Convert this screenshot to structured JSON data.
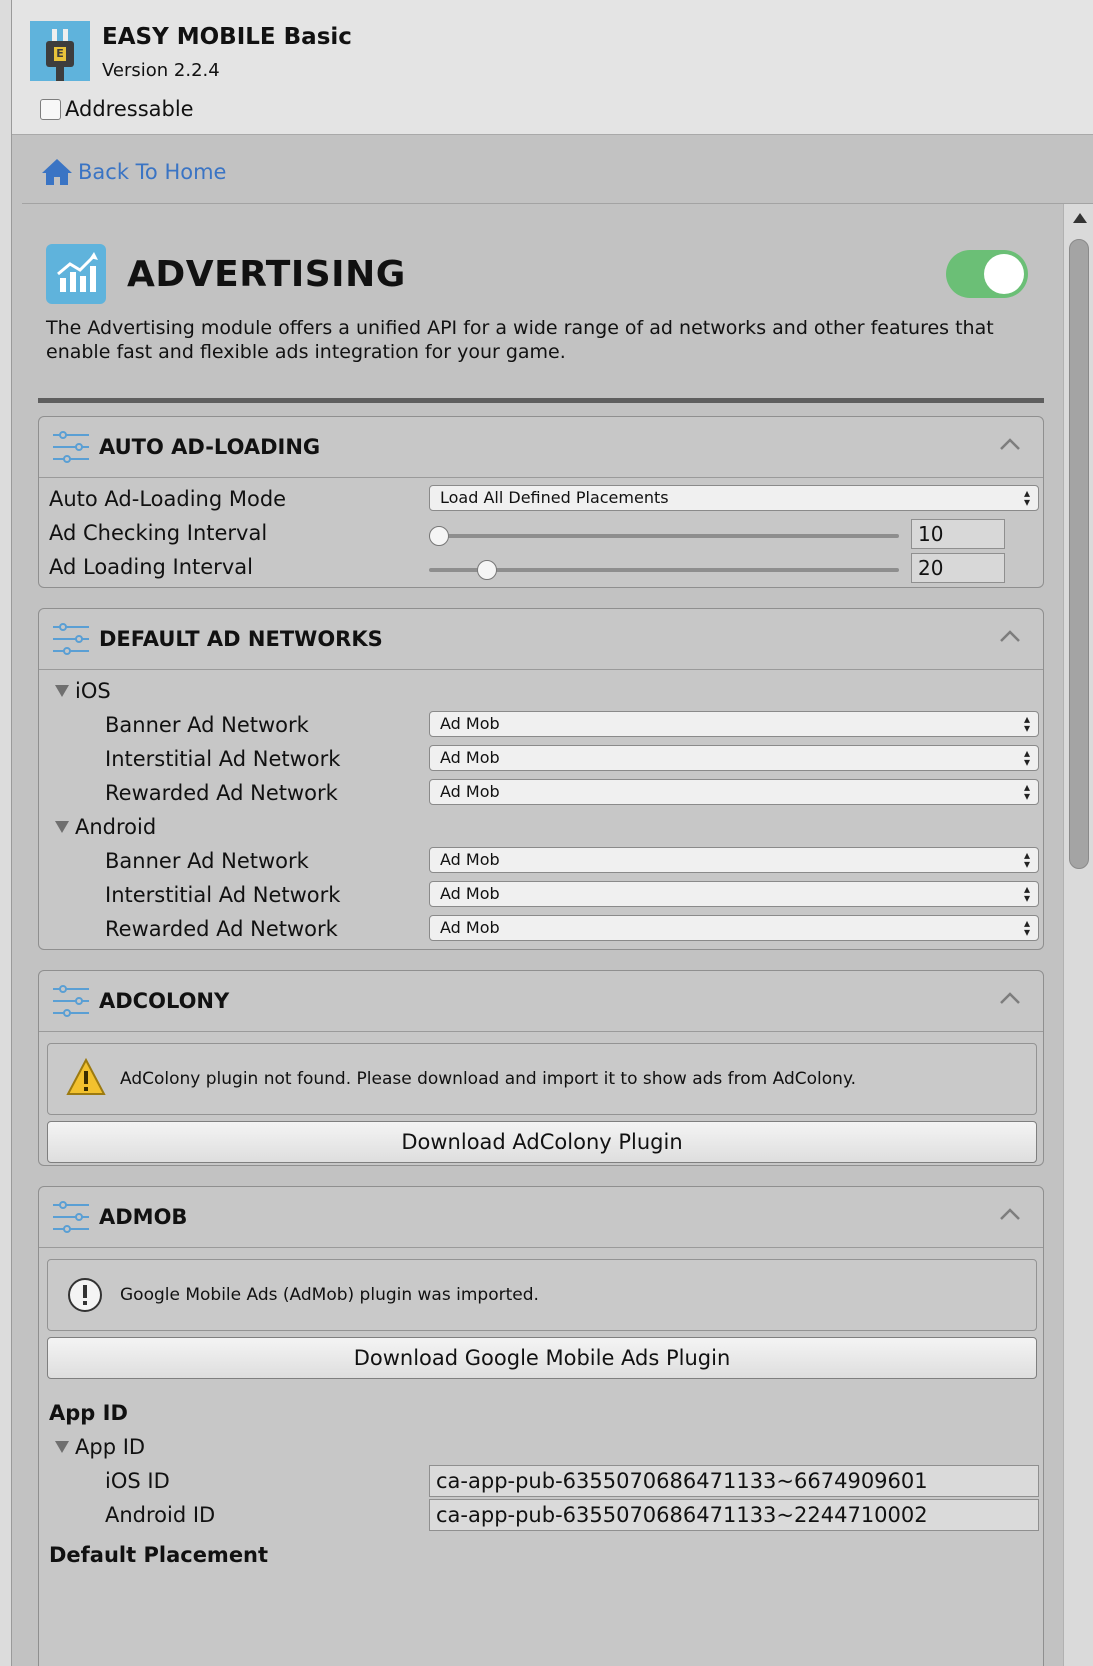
{
  "header": {
    "app_title": "EASY MOBILE Basic",
    "version": "Version 2.2.4",
    "addressable_label": "Addressable",
    "addressable_checked": false
  },
  "nav": {
    "back_label": "Back To Home"
  },
  "module": {
    "title": "ADVERTISING",
    "enabled": true,
    "description": "The Advertising module offers a unified API for a wide range of ad networks and other features that enable fast and flexible ads integration for your game."
  },
  "auto_loading": {
    "title": "AUTO AD-LOADING",
    "mode_label": "Auto Ad-Loading Mode",
    "mode_value": "Load All Defined Placements",
    "checking_label": "Ad Checking Interval",
    "checking_value": "10",
    "loading_label": "Ad Loading Interval",
    "loading_value": "20"
  },
  "default_networks": {
    "title": "DEFAULT AD NETWORKS",
    "ios_label": "iOS",
    "android_label": "Android",
    "ios": [
      {
        "label": "Banner Ad Network",
        "value": "Ad Mob"
      },
      {
        "label": "Interstitial Ad Network",
        "value": "Ad Mob"
      },
      {
        "label": "Rewarded Ad Network",
        "value": "Ad Mob"
      }
    ],
    "android": [
      {
        "label": "Banner Ad Network",
        "value": "Ad Mob"
      },
      {
        "label": "Interstitial Ad Network",
        "value": "Ad Mob"
      },
      {
        "label": "Rewarded Ad Network",
        "value": "Ad Mob"
      }
    ]
  },
  "adcolony": {
    "title": "ADCOLONY",
    "warning": "AdColony plugin not found. Please download and import it to show ads from AdColony.",
    "button": "Download AdColony Plugin"
  },
  "admob": {
    "title": "ADMOB",
    "info": "Google Mobile Ads (AdMob) plugin was imported.",
    "button": "Download Google Mobile Ads Plugin",
    "app_id_heading": "App ID",
    "app_id_fold": "App ID",
    "ios_id_label": "iOS ID",
    "ios_id": "ca-app-pub-6355070686471133~6674909601",
    "android_id_label": "Android ID",
    "android_id": "ca-app-pub-6355070686471133~2244710002",
    "default_placement": "Default Placement"
  },
  "colors": {
    "accent_blue": "#5fb3dc",
    "toggle_green": "#6bbf76",
    "link_blue": "#3a74c4"
  }
}
